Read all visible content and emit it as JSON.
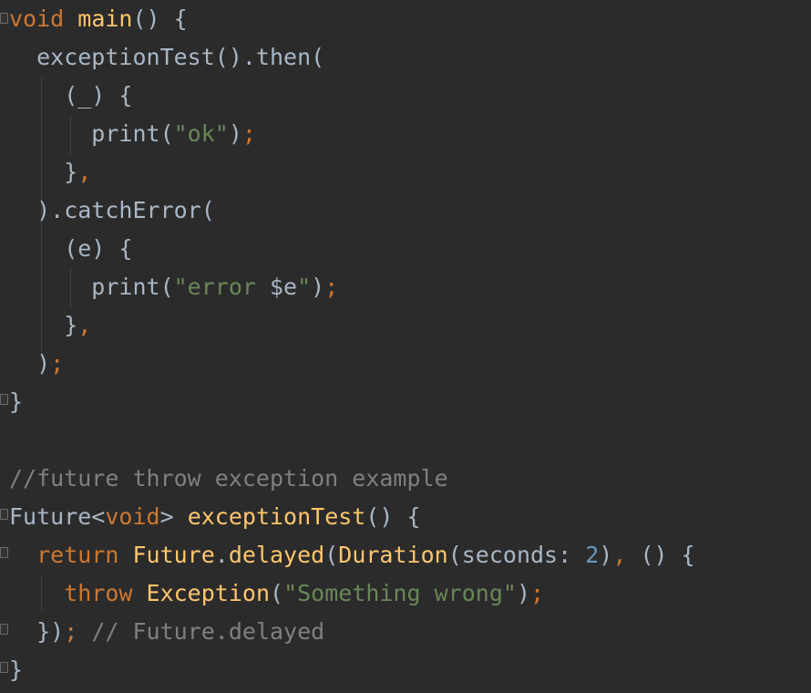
{
  "editor": {
    "colors": {
      "background": "#2b2b2b",
      "keyword": "#cc7832",
      "function": "#ffc66d",
      "string": "#6a8759",
      "number": "#6897bb",
      "comment": "#808080",
      "text": "#a9b7c6"
    },
    "lines": [
      [
        {
          "k": "kw",
          "t": "void"
        },
        {
          "k": "plain",
          "t": " "
        },
        {
          "k": "fn",
          "t": "main"
        },
        {
          "k": "plain",
          "t": "() {"
        }
      ],
      [
        {
          "k": "plain",
          "t": "  exceptionTest().then("
        }
      ],
      [
        {
          "k": "plain",
          "t": "    (_) {"
        }
      ],
      [
        {
          "k": "plain",
          "t": "      print("
        },
        {
          "k": "str",
          "t": "\"ok\""
        },
        {
          "k": "plain",
          "t": ")"
        },
        {
          "k": "kw",
          "t": ";"
        }
      ],
      [
        {
          "k": "plain",
          "t": "    }"
        },
        {
          "k": "kw",
          "t": ","
        }
      ],
      [
        {
          "k": "plain",
          "t": "  ).catchError("
        }
      ],
      [
        {
          "k": "plain",
          "t": "    (e) {"
        }
      ],
      [
        {
          "k": "plain",
          "t": "      print("
        },
        {
          "k": "str",
          "t": "\"error "
        },
        {
          "k": "plain",
          "t": "$e"
        },
        {
          "k": "str",
          "t": "\""
        },
        {
          "k": "plain",
          "t": ")"
        },
        {
          "k": "kw",
          "t": ";"
        }
      ],
      [
        {
          "k": "plain",
          "t": "    }"
        },
        {
          "k": "kw",
          "t": ","
        }
      ],
      [
        {
          "k": "plain",
          "t": "  )"
        },
        {
          "k": "kw",
          "t": ";"
        }
      ],
      [
        {
          "k": "plain",
          "t": "}"
        }
      ],
      [
        {
          "k": "plain",
          "t": ""
        }
      ],
      [
        {
          "k": "cmt",
          "t": "//future throw exception example"
        }
      ],
      [
        {
          "k": "plain",
          "t": "Future<"
        },
        {
          "k": "kw",
          "t": "void"
        },
        {
          "k": "plain",
          "t": "> "
        },
        {
          "k": "fn",
          "t": "exceptionTest"
        },
        {
          "k": "plain",
          "t": "() {"
        }
      ],
      [
        {
          "k": "plain",
          "t": "  "
        },
        {
          "k": "kw",
          "t": "return "
        },
        {
          "k": "fn",
          "t": "Future"
        },
        {
          "k": "plain",
          "t": "."
        },
        {
          "k": "fn",
          "t": "delayed"
        },
        {
          "k": "plain",
          "t": "("
        },
        {
          "k": "fn",
          "t": "Duration"
        },
        {
          "k": "plain",
          "t": "(seconds: "
        },
        {
          "k": "num",
          "t": "2"
        },
        {
          "k": "plain",
          "t": ")"
        },
        {
          "k": "kw",
          "t": ", "
        },
        {
          "k": "plain",
          "t": "() {"
        }
      ],
      [
        {
          "k": "plain",
          "t": "    "
        },
        {
          "k": "kw",
          "t": "throw "
        },
        {
          "k": "fn",
          "t": "Exception"
        },
        {
          "k": "plain",
          "t": "("
        },
        {
          "k": "str",
          "t": "\"Something wrong\""
        },
        {
          "k": "plain",
          "t": ")"
        },
        {
          "k": "kw",
          "t": ";"
        }
      ],
      [
        {
          "k": "plain",
          "t": "  })"
        },
        {
          "k": "kw",
          "t": ";"
        },
        {
          "k": "cmt",
          "t": " // Future.delayed"
        }
      ],
      [
        {
          "k": "plain",
          "t": "}"
        }
      ]
    ]
  }
}
